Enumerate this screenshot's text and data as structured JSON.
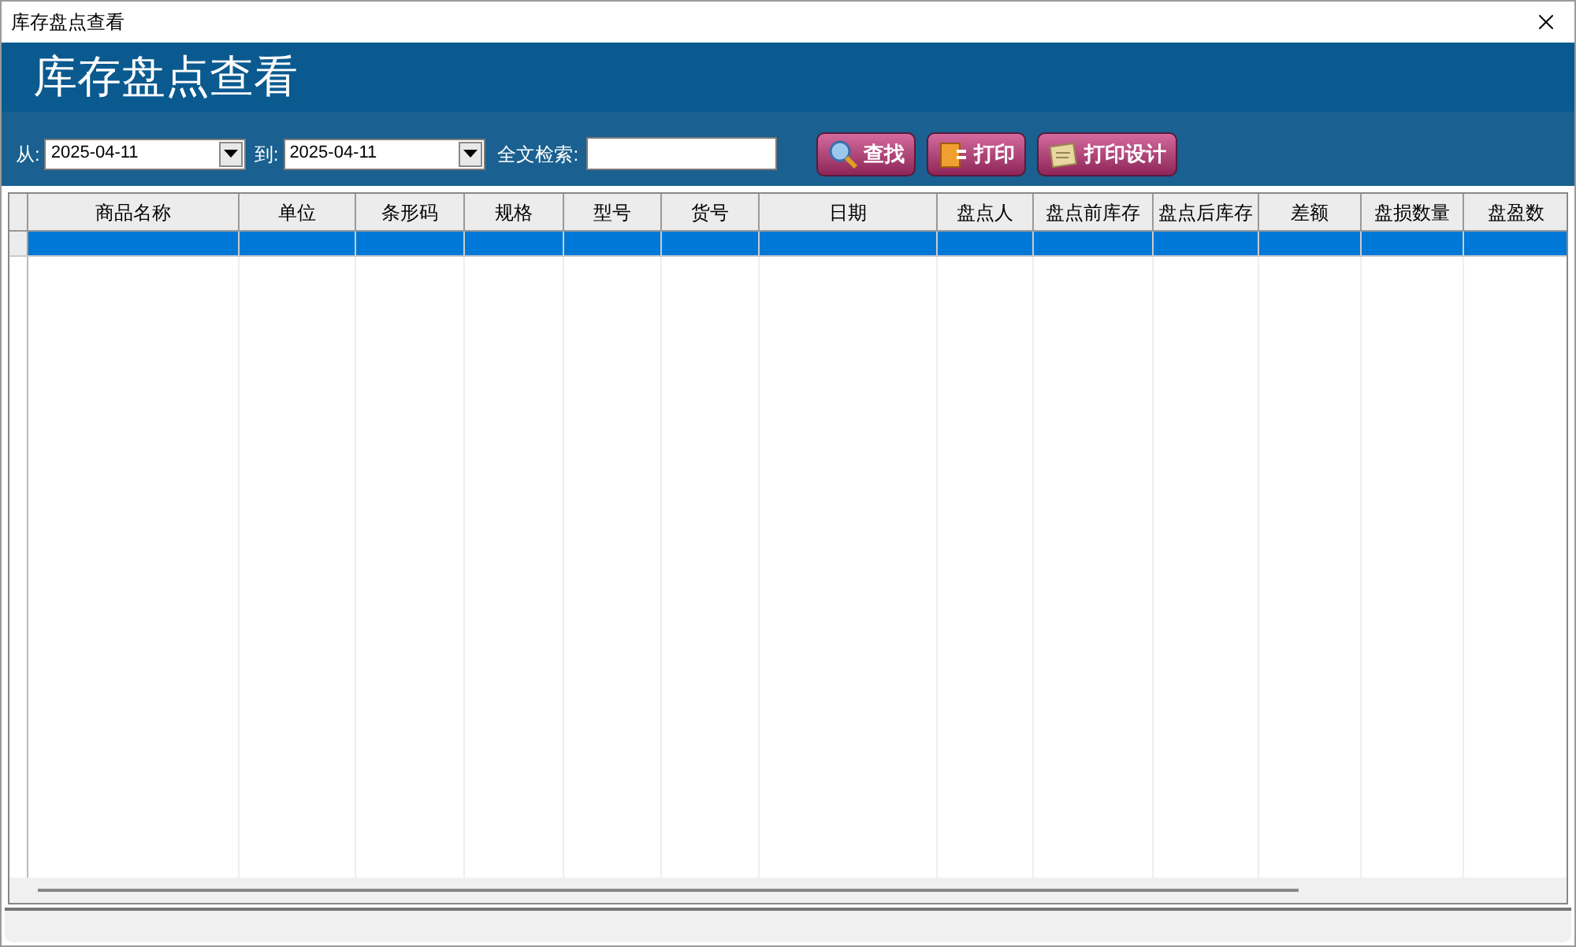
{
  "window": {
    "title": "库存盘点查看"
  },
  "header": {
    "title": "库存盘点查看"
  },
  "filters": {
    "from_label": "从:",
    "from_value": "2025-04-11",
    "to_label": "到:",
    "to_value": "2025-04-11",
    "search_label": "全文检索:"
  },
  "buttons": [
    {
      "label": "查找",
      "kind": "search"
    },
    {
      "label": "打印",
      "kind": "print"
    },
    {
      "label": "打印设计",
      "kind": "design"
    }
  ],
  "table": {
    "columns": [
      "商品名称",
      "单位",
      "条形码",
      "规格",
      "型号",
      "货号",
      "日期",
      "盘点人",
      "盘点前库存",
      "盘点后库存",
      "差额",
      "盘损数量",
      "盘盈数"
    ],
    "rows": [
      {
        "selected": true
      }
    ]
  }
}
